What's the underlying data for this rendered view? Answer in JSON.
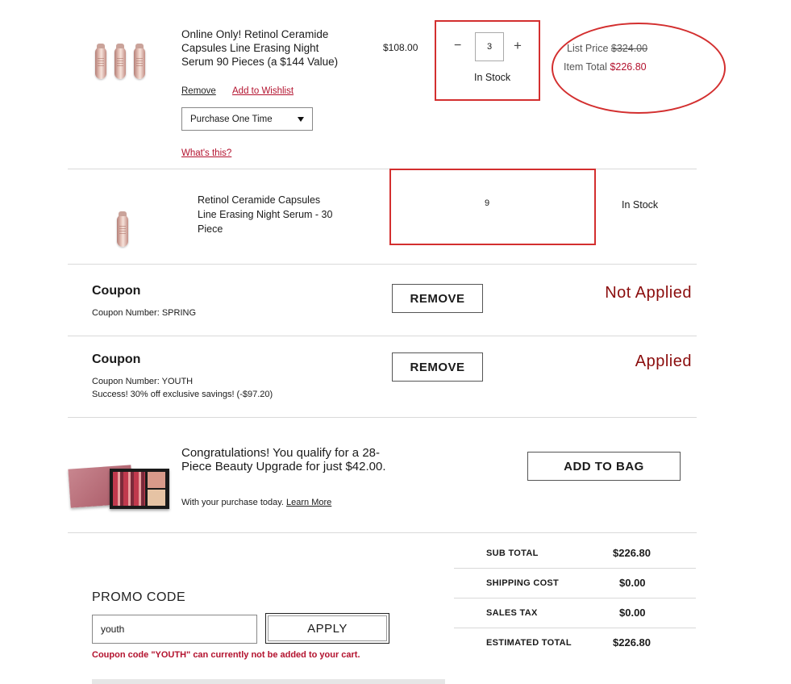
{
  "items": [
    {
      "title": "Online Only! Retinol Ceramide Capsules Line Erasing Night Serum 90 Pieces (a $144 Value)",
      "price": "$108.00",
      "remove_label": "Remove",
      "wishlist_label": "Add to Wishlist",
      "purchase_option": "Purchase One Time",
      "whats_this": "What's this?",
      "qty_minus": "−",
      "qty_value": "3",
      "qty_plus": "+",
      "stock": "In Stock",
      "list_price_label": "List Price",
      "list_price_value": "$324.00",
      "item_total_label": "Item Total",
      "item_total_value": "$226.80"
    },
    {
      "title": "Retinol Ceramide Capsules Line Erasing Night Serum - 30 Piece",
      "qty_value": "9",
      "stock": "In Stock"
    }
  ],
  "coupons": [
    {
      "heading": "Coupon",
      "number_text": "Coupon Number: SPRING",
      "remove_label": "REMOVE",
      "status": "Not Applied"
    },
    {
      "heading": "Coupon",
      "number_text": "Coupon Number: YOUTH",
      "success_text": "Success! 30% off exclusive savings! (-$97.20)",
      "remove_label": "REMOVE",
      "status": "Applied"
    }
  ],
  "upgrade": {
    "message": "Congratulations! You qualify for a 28-Piece Beauty Upgrade for just $42.00.",
    "subtext": "With your purchase today.",
    "learn_more": "Learn More",
    "add_label": "ADD TO BAG"
  },
  "promo": {
    "heading": "PROMO CODE",
    "value": "youth",
    "apply_label": "APPLY",
    "error": "Coupon code \"YOUTH\" can currently not be added to your cart."
  },
  "summary": {
    "rows": [
      {
        "label": "SUB TOTAL",
        "value": "$226.80"
      },
      {
        "label": "SHIPPING COST",
        "value": "$0.00"
      },
      {
        "label": "SALES TAX",
        "value": "$0.00"
      },
      {
        "label": "ESTIMATED TOTAL",
        "value": "$226.80"
      }
    ]
  },
  "colors": {
    "accent_red": "#b3122e",
    "status_dark_red": "#8b0d0d",
    "annotation_red": "#d32f2f"
  }
}
